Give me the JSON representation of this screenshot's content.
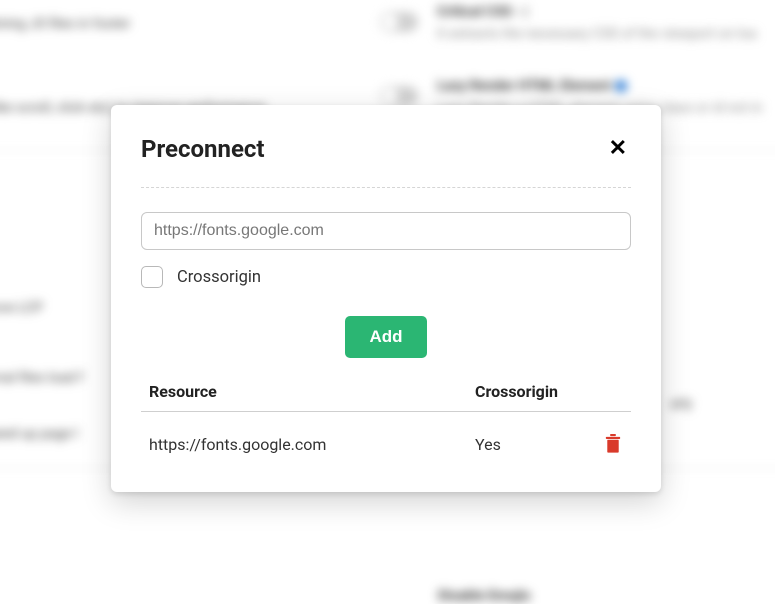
{
  "background": {
    "left_labels": [
      "nbining JS files in footer",
      "n-like scroll, click etc) to improve performance",
      "prove LCP",
      "ternal files load f",
      "speed up page l"
    ],
    "right_items": [
      {
        "title": "Critical CSS - |",
        "desc": "It extracts the necessary CSS of the viewport on loa"
      },
      {
        "title": "Lazy Render HTML Element",
        "desc": "Lazy Render a HTML element using class or id not in vi"
      }
    ],
    "bottom_heading": "Disable Emojis"
  },
  "modal": {
    "title": "Preconnect",
    "input_placeholder": "https://fonts.google.com",
    "input_value": "",
    "checkbox_label": "Crossorigin",
    "add_label": "Add",
    "headers": {
      "resource": "Resource",
      "crossorigin": "Crossorigin"
    },
    "rows": [
      {
        "resource": "https://fonts.google.com",
        "crossorigin": "Yes"
      }
    ]
  }
}
